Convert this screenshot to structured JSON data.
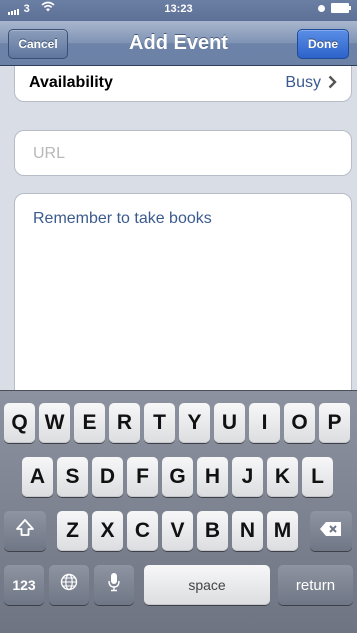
{
  "status_bar": {
    "carrier": "3",
    "time": "13:23"
  },
  "nav": {
    "title": "Add Event",
    "cancel_label": "Cancel",
    "done_label": "Done"
  },
  "form": {
    "availability_label": "Availability",
    "availability_value": "Busy",
    "url_placeholder": "URL",
    "notes_text": "Remember to take books"
  },
  "keyboard": {
    "row1": [
      "Q",
      "W",
      "E",
      "R",
      "T",
      "Y",
      "U",
      "I",
      "O",
      "P"
    ],
    "row2": [
      "A",
      "S",
      "D",
      "F",
      "G",
      "H",
      "J",
      "K",
      "L"
    ],
    "row3": [
      "Z",
      "X",
      "C",
      "V",
      "B",
      "N",
      "M"
    ],
    "numbers_label": "123",
    "space_label": "space",
    "return_label": "return"
  },
  "icons": {
    "signal": "signal-icon",
    "wifi": "wifi-icon",
    "battery": "battery-icon",
    "chevron": "chevron-right-icon",
    "shift": "shift-icon",
    "delete": "delete-icon",
    "globe": "globe-icon",
    "mic": "microphone-icon"
  }
}
